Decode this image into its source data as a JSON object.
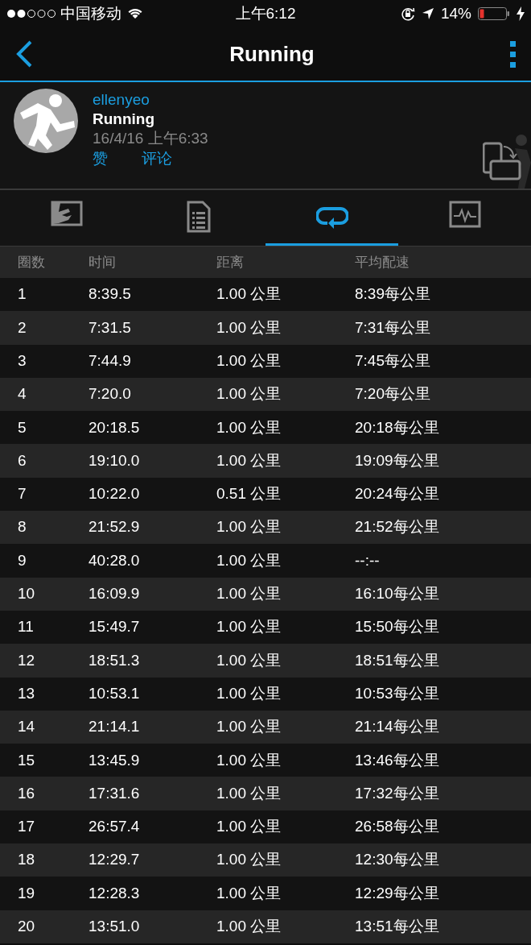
{
  "status_bar": {
    "carrier": "中国移动",
    "time": "上午6:12",
    "battery": "14%"
  },
  "nav": {
    "title": "Running"
  },
  "activity": {
    "user": "ellenyeo",
    "type": "Running",
    "date": "16/4/16 上午6:33",
    "actions": [
      "赞",
      "评论"
    ]
  },
  "tabs": [
    {
      "kind": "map",
      "selected": false
    },
    {
      "kind": "details",
      "selected": false
    },
    {
      "kind": "laps",
      "selected": true
    },
    {
      "kind": "chart",
      "selected": false
    }
  ],
  "table": {
    "columns": [
      "圈数",
      "时间",
      "距离",
      "平均配速"
    ],
    "rows": [
      [
        "1",
        "8:39.5",
        "1.00 公里",
        "8:39每公里"
      ],
      [
        "2",
        "7:31.5",
        "1.00 公里",
        "7:31每公里"
      ],
      [
        "3",
        "7:44.9",
        "1.00 公里",
        "7:45每公里"
      ],
      [
        "4",
        "7:20.0",
        "1.00 公里",
        "7:20每公里"
      ],
      [
        "5",
        "20:18.5",
        "1.00 公里",
        "20:18每公里"
      ],
      [
        "6",
        "19:10.0",
        "1.00 公里",
        "19:09每公里"
      ],
      [
        "7",
        "10:22.0",
        "0.51 公里",
        "20:24每公里"
      ],
      [
        "8",
        "21:52.9",
        "1.00 公里",
        "21:52每公里"
      ],
      [
        "9",
        "40:28.0",
        "1.00 公里",
        "--:--"
      ],
      [
        "10",
        "16:09.9",
        "1.00 公里",
        "16:10每公里"
      ],
      [
        "11",
        "15:49.7",
        "1.00 公里",
        "15:50每公里"
      ],
      [
        "12",
        "18:51.3",
        "1.00 公里",
        "18:51每公里"
      ],
      [
        "13",
        "10:53.1",
        "1.00 公里",
        "10:53每公里"
      ],
      [
        "14",
        "21:14.1",
        "1.00 公里",
        "21:14每公里"
      ],
      [
        "15",
        "13:45.9",
        "1.00 公里",
        "13:46每公里"
      ],
      [
        "16",
        "17:31.6",
        "1.00 公里",
        "17:32每公里"
      ],
      [
        "17",
        "26:57.4",
        "1.00 公里",
        "26:58每公里"
      ],
      [
        "18",
        "12:29.7",
        "1.00 公里",
        "12:30每公里"
      ],
      [
        "19",
        "12:28.3",
        "1.00 公里",
        "12:29每公里"
      ],
      [
        "20",
        "13:51.0",
        "1.00 公里",
        "13:51每公里"
      ]
    ]
  }
}
